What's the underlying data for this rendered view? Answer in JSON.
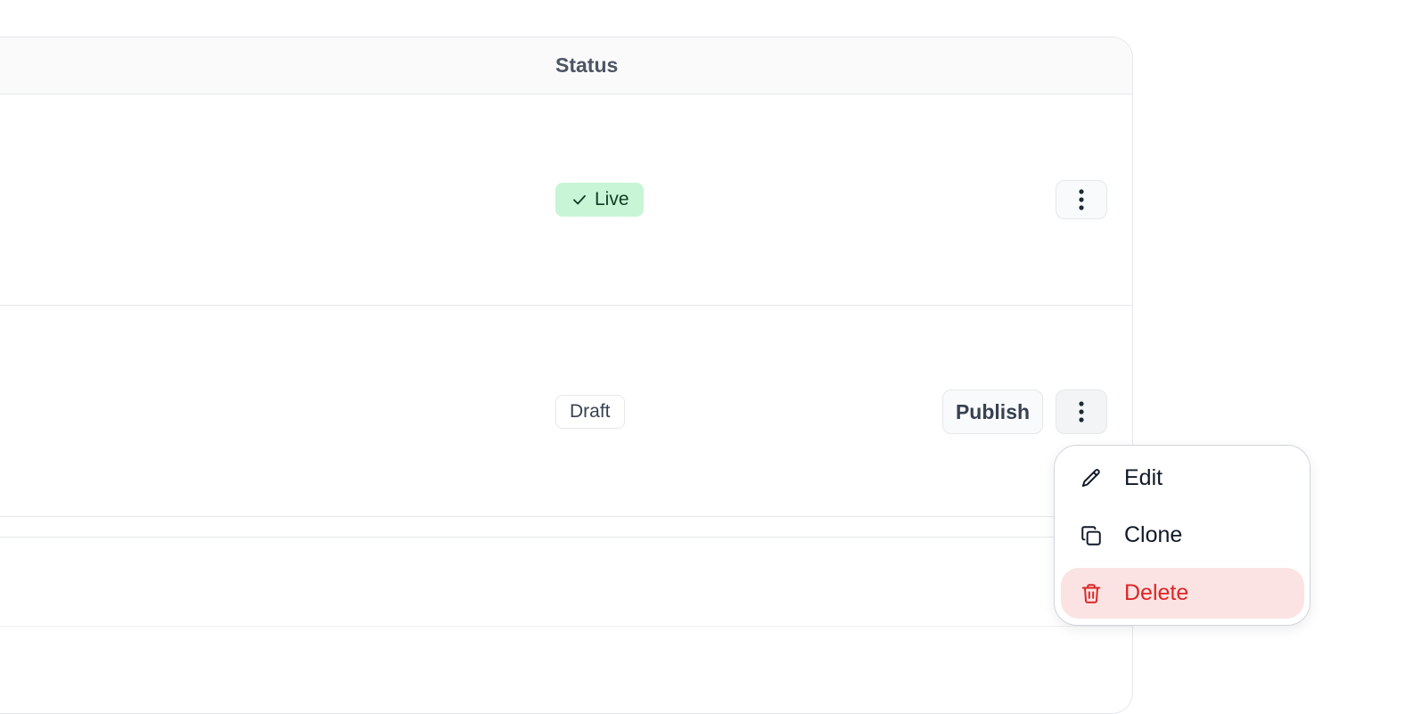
{
  "table": {
    "columns": {
      "status": "Status"
    },
    "rows": [
      {
        "status": "Live",
        "status_color": "#c8f5d6"
      },
      {
        "status": "Draft",
        "action_label": "Publish"
      }
    ]
  },
  "menu": {
    "items": [
      {
        "label": "Edit",
        "icon": "pencil-icon"
      },
      {
        "label": "Clone",
        "icon": "copy-icon"
      },
      {
        "label": "Delete",
        "icon": "trash-icon",
        "color": "#dc2626",
        "highlight": "#fbe3e3"
      }
    ]
  }
}
